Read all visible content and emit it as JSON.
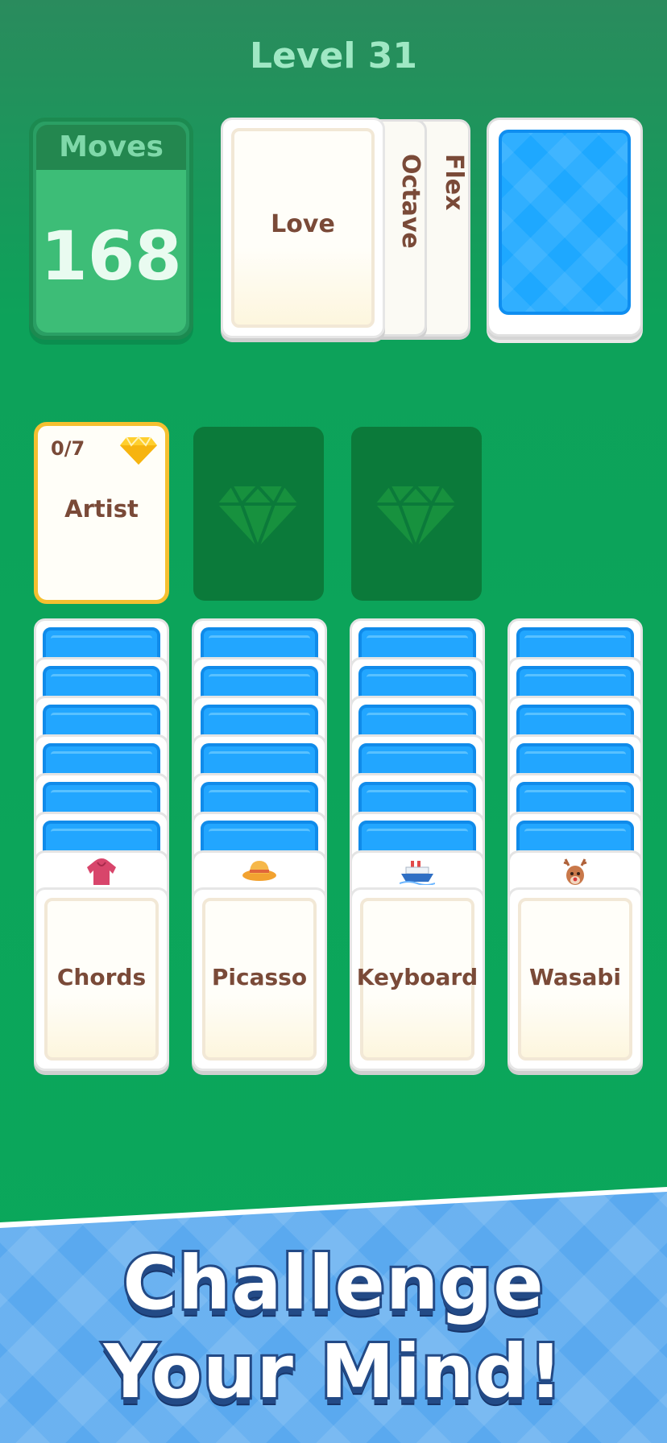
{
  "header": {
    "level": "Level 31"
  },
  "moves": {
    "label": "Moves",
    "count": "168"
  },
  "waste": {
    "top": "Love",
    "behind": [
      "Octave",
      "Flex"
    ]
  },
  "foundation": {
    "active": {
      "progress": "0/7",
      "label": "Artist",
      "icon": "diamond-icon"
    },
    "slots": 2
  },
  "tableau": [
    {
      "hidden": 6,
      "peek_icon": "hoodie-icon",
      "top": "Chords"
    },
    {
      "hidden": 6,
      "peek_icon": "hat-icon",
      "top": "Picasso"
    },
    {
      "hidden": 6,
      "peek_icon": "ship-icon",
      "top": "Keyboard"
    },
    {
      "hidden": 6,
      "peek_icon": "deer-icon",
      "top": "Wasabi"
    }
  ],
  "banner": {
    "line1": "Challenge",
    "line2": "Your Mind!"
  },
  "colors": {
    "felt": "#0aa85b",
    "card_back": "#1ea8ff",
    "gold": "#f5c030",
    "text": "#7a4a38"
  }
}
